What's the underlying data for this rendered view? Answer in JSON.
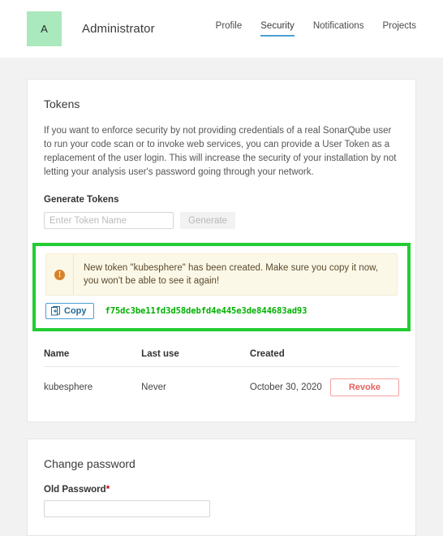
{
  "header": {
    "avatar_initial": "A",
    "user_name": "Administrator",
    "nav": [
      {
        "label": "Profile",
        "active": false
      },
      {
        "label": "Security",
        "active": true
      },
      {
        "label": "Notifications",
        "active": false
      },
      {
        "label": "Projects",
        "active": false
      }
    ]
  },
  "tokens_card": {
    "title": "Tokens",
    "description": "If you want to enforce security by not providing credentials of a real SonarQube user to run your code scan or to invoke web services, you can provide a User Token as a replacement of the user login. This will increase the security of your installation by not letting your analysis user's password going through your network.",
    "generate_label": "Generate Tokens",
    "token_name_placeholder": "Enter Token Name",
    "token_name_value": "",
    "generate_button_label": "Generate",
    "alert": {
      "icon": "warning-icon",
      "message": "New token \"kubesphere\" has been created. Make sure you copy it now, you won't be able to see it again!"
    },
    "copy_button_label": "Copy",
    "copy_icon": "clipboard-icon",
    "token_value": "f75dc3be11fd3d58debfd4e445e3de844683ad93",
    "table": {
      "columns": [
        "Name",
        "Last use",
        "Created",
        ""
      ],
      "rows": [
        {
          "name": "kubesphere",
          "last_use": "Never",
          "created": "October 30, 2020",
          "action_label": "Revoke"
        }
      ]
    }
  },
  "password_card": {
    "title": "Change password",
    "old_password_label": "Old Password",
    "old_password_required": "*",
    "old_password_value": ""
  },
  "colors": {
    "accent_blue": "#4b9fd5",
    "avatar_green": "#aae8bd",
    "highlight_green": "#22cc33",
    "token_green": "#00b000",
    "warning_orange": "#d9822b",
    "alert_bg": "#fcf8e8",
    "revoke_red": "#e8615f",
    "page_bg": "#f2f2f2"
  }
}
